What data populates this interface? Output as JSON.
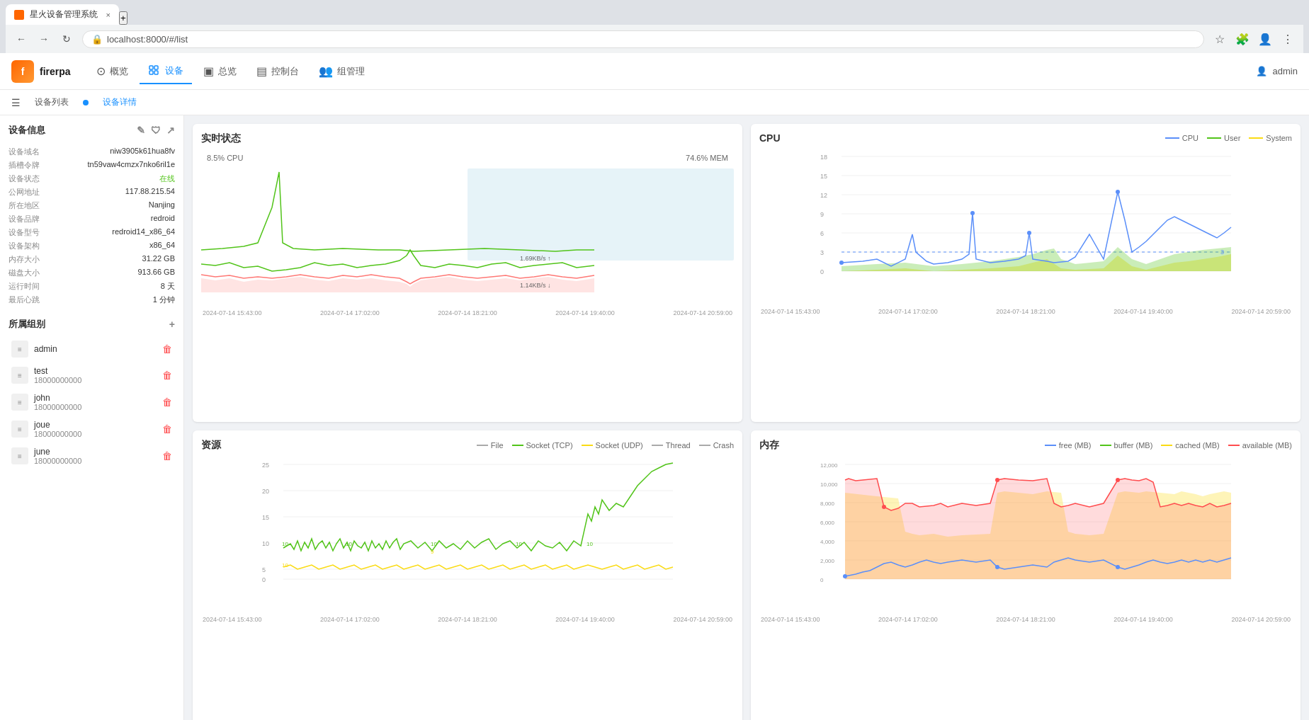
{
  "browser": {
    "tab_title": "星火设备管理系统",
    "url": "localhost:8000/#/list",
    "new_tab_label": "+",
    "close_tab": "×"
  },
  "app": {
    "logo_text": "firerpa",
    "nav_items": [
      {
        "label": "概览",
        "icon": "⊙",
        "active": false
      },
      {
        "label": "设备",
        "icon": "⊞",
        "active": true
      },
      {
        "label": "总览",
        "icon": "▣",
        "active": false
      },
      {
        "label": "控制台",
        "icon": "▤",
        "active": false
      },
      {
        "label": "组管理",
        "icon": "⊞",
        "active": false
      }
    ],
    "user": "admin",
    "sub_nav": {
      "list_label": "设备列表",
      "detail_label": "设备详情"
    }
  },
  "device_info": {
    "title": "设备信息",
    "fields": [
      {
        "label": "设备域名",
        "value": "niw3905k61hua8fv"
      },
      {
        "label": "插槽令牌",
        "value": "tn59vaw4cmzx7nko6ril1e"
      },
      {
        "label": "设备状态",
        "value": "在线",
        "status": "online"
      },
      {
        "label": "公网地址",
        "value": "117.88.215.54"
      },
      {
        "label": "所在地区",
        "value": "Nanjing"
      },
      {
        "label": "设备品牌",
        "value": "redroid"
      },
      {
        "label": "设备型号",
        "value": "redroid14_x86_64"
      },
      {
        "label": "设备架构",
        "value": "x86_64"
      },
      {
        "label": "内存大小",
        "value": "31.22 GB"
      },
      {
        "label": "磁盘大小",
        "value": "913.66 GB"
      },
      {
        "label": "运行时间",
        "value": "8 天"
      },
      {
        "label": "最后心跳",
        "value": "1 分钟"
      }
    ]
  },
  "groups": {
    "title": "所属组别",
    "add_label": "+",
    "items": [
      {
        "name": "admin",
        "phone": ""
      },
      {
        "name": "test",
        "phone": "18000000000"
      },
      {
        "name": "john",
        "phone": "18000000000"
      },
      {
        "name": "joue",
        "phone": "18000000000"
      },
      {
        "name": "june",
        "phone": "18000000000"
      }
    ]
  },
  "charts": {
    "realtime": {
      "title": "实时状态",
      "cpu_label": "8.5% CPU",
      "mem_label": "74.6% MEM",
      "speed_up": "1.69KB/s ↑",
      "speed_down": "1.14KB/s ↓"
    },
    "cpu": {
      "title": "CPU",
      "legend": [
        {
          "label": "CPU",
          "color": "#5b8ff9"
        },
        {
          "label": "User",
          "color": "#52c41a"
        },
        {
          "label": "System",
          "color": "#fadb14"
        }
      ],
      "y_max": 18,
      "y_labels": [
        "18",
        "15",
        "12",
        "9",
        "6",
        "3",
        "0"
      ],
      "x_labels": [
        "2024-07-14 15:43:00",
        "2024-07-14 17:02:00",
        "2024-07-14 18:21:00",
        "2024-07-14 19:40:00",
        "2024-07-14 20:59:00"
      ]
    },
    "resource": {
      "title": "资源",
      "legend": [
        {
          "label": "File",
          "color": "#aaa"
        },
        {
          "label": "Socket (TCP)",
          "color": "#52c41a"
        },
        {
          "label": "Socket (UDP)",
          "color": "#fadb14"
        },
        {
          "label": "Thread",
          "color": "#aaa"
        },
        {
          "label": "Crash",
          "color": "#aaa"
        }
      ],
      "y_labels": [
        "25",
        "20",
        "15",
        "10",
        "5",
        "0"
      ],
      "x_labels": [
        "2024-07-14 15:43:00",
        "2024-07-14 17:02:00",
        "2024-07-14 18:21:00",
        "2024-07-14 19:40:00",
        "2024-07-14 20:59:00"
      ]
    },
    "memory": {
      "title": "内存",
      "legend": [
        {
          "label": "free (MB)",
          "color": "#5b8ff9"
        },
        {
          "label": "buffer (MB)",
          "color": "#52c41a"
        },
        {
          "label": "cached (MB)",
          "color": "#fadb14"
        },
        {
          "label": "available (MB)",
          "color": "#ff4d4f"
        }
      ],
      "y_labels": [
        "12,000",
        "10,000",
        "8,000",
        "6,000",
        "4,000",
        "2,000",
        "0"
      ],
      "x_labels": [
        "2024-07-14 15:43:00",
        "2024-07-14 17:02:00",
        "2024-07-14 18:21:00",
        "2024-07-14 19:40:00",
        "2024-07-14 20:59:00"
      ]
    }
  }
}
